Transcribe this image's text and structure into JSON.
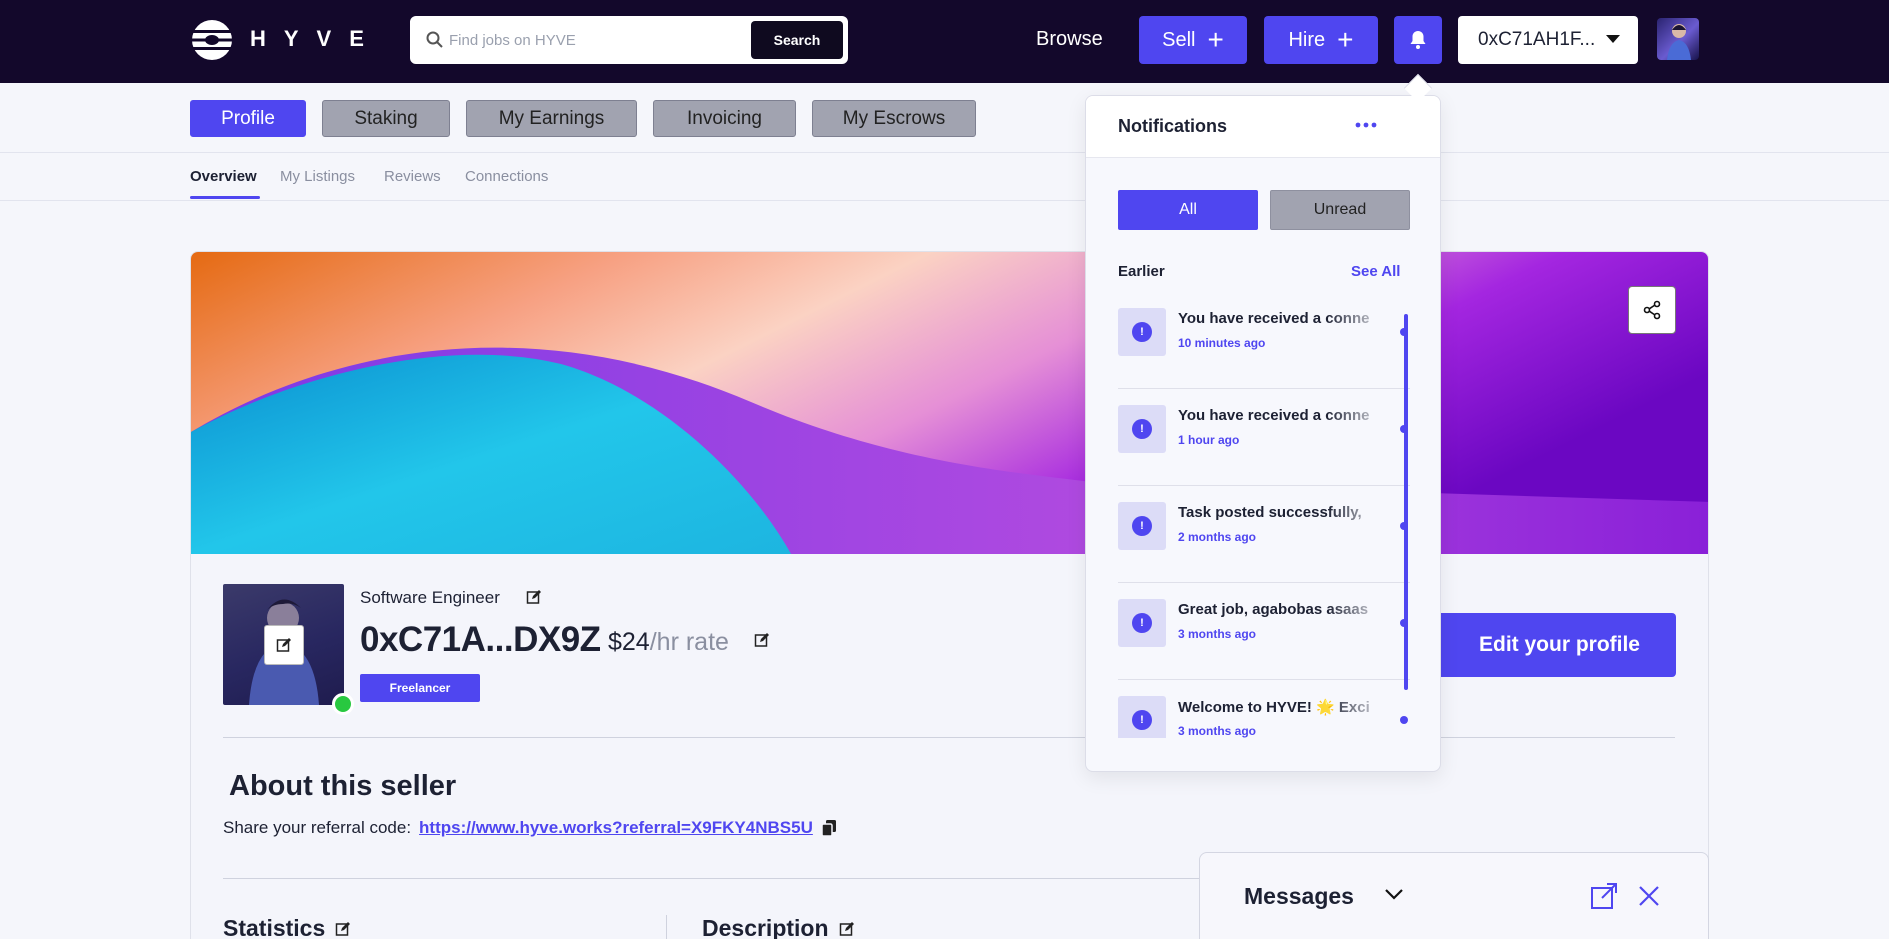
{
  "brand": {
    "name": "HYVE"
  },
  "header": {
    "search_placeholder": "Find jobs on HYVE",
    "search_button": "Search",
    "browse": "Browse",
    "sell": "Sell",
    "hire": "Hire",
    "wallet": "0xC71AH1F..."
  },
  "tabs": [
    "Profile",
    "Staking",
    "My Earnings",
    "Invoicing",
    "My Escrows"
  ],
  "subtabs": [
    "Overview",
    "My Listings",
    "Reviews",
    "Connections"
  ],
  "profile": {
    "role": "Software Engineer",
    "name": "0xC71A...DX9Z",
    "rate": "$24",
    "rate_unit": "/hr rate",
    "badge": "Freelancer",
    "edit_button": "Edit your profile",
    "about_title": "About this seller",
    "referral_label": "Share your referral code:",
    "referral_link": "https://www.hyve.works?referral=X9FKY4NBS5U",
    "statistics": "Statistics",
    "description": "Description"
  },
  "messages": {
    "title": "Messages"
  },
  "notifications": {
    "title": "Notifications",
    "filter_all": "All",
    "filter_unread": "Unread",
    "section": "Earlier",
    "see_all": "See All",
    "items": [
      {
        "text": "You have received a conne",
        "time": "10 minutes ago"
      },
      {
        "text": "You have received a conne",
        "time": "1 hour ago"
      },
      {
        "text": "Task posted successfully,",
        "time": "2 months ago"
      },
      {
        "text": "Great job, agabobas asaas",
        "time": "3 months ago"
      },
      {
        "text": "Welcome to HYVE! 🌟 Exci",
        "time": "3 months ago"
      }
    ]
  },
  "colors": {
    "accent": "#4f46f0",
    "header_bg": "#13082b",
    "online": "#28c840"
  }
}
